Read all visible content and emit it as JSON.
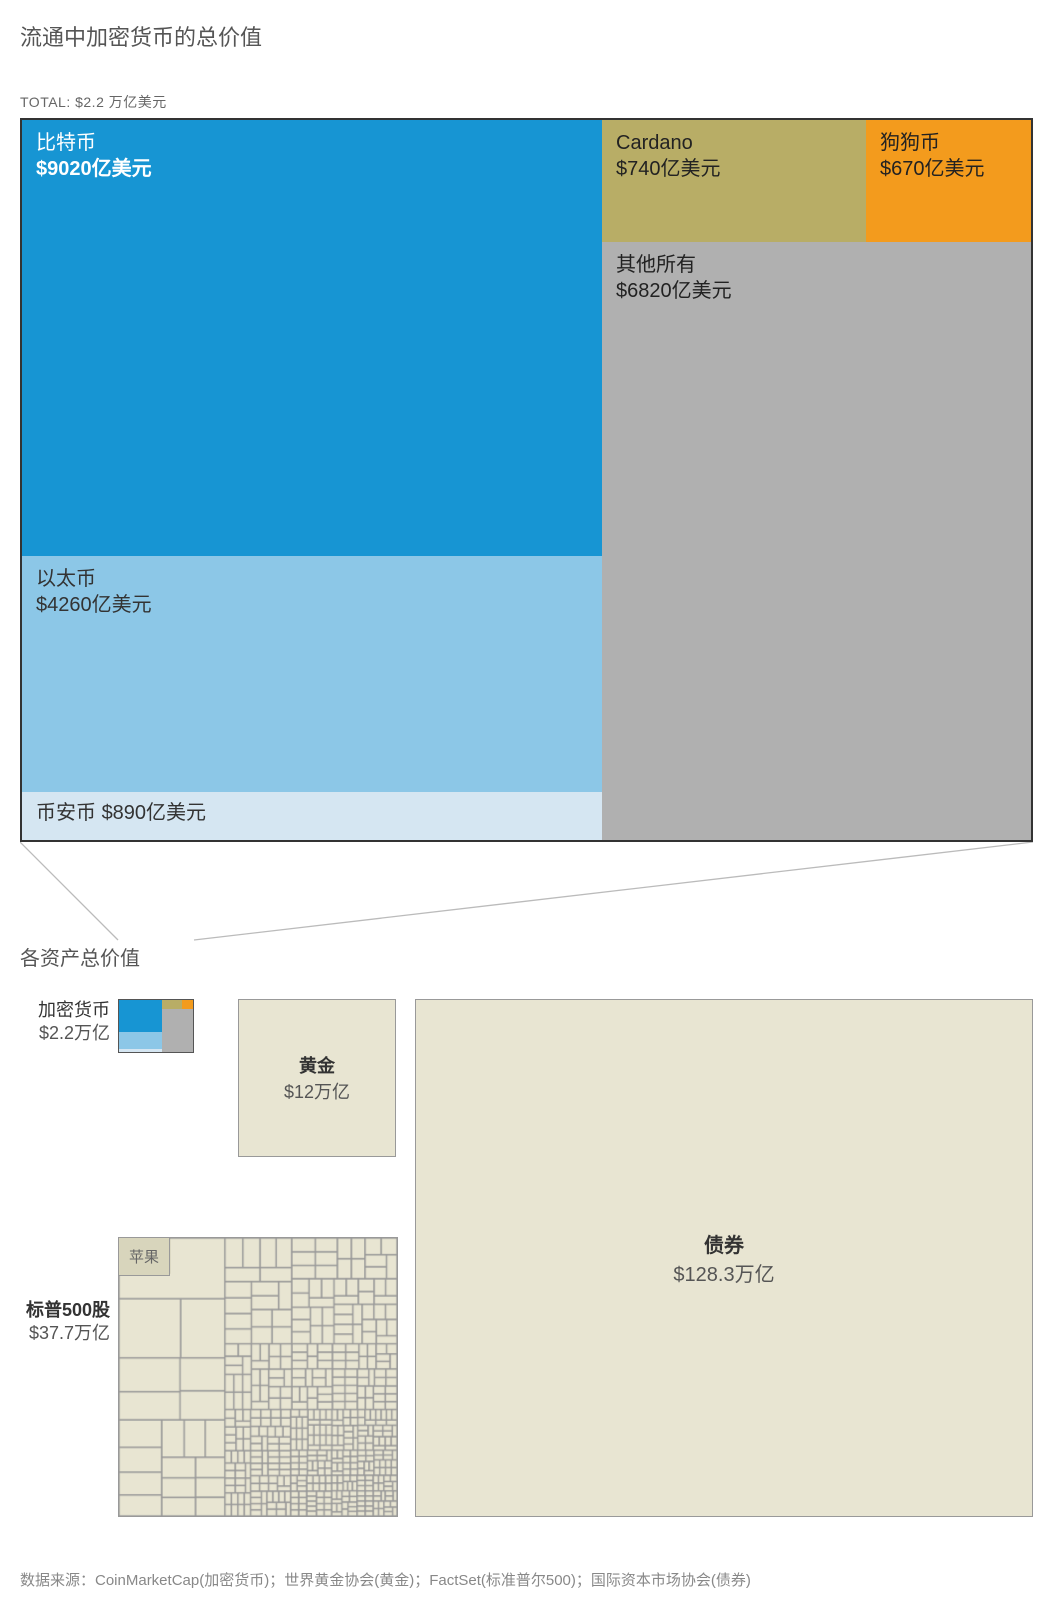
{
  "title": "流通中加密货币的总价值",
  "total_label": "TOTAL: $2.2 万亿美元",
  "crypto": {
    "bitcoin": {
      "name": "比特币",
      "value": "$9020亿美元"
    },
    "ether": {
      "name": "以太币",
      "value": "$4260亿美元"
    },
    "binance": {
      "name": "币安币",
      "value": "$890亿美元"
    },
    "cardano": {
      "name": "Cardano",
      "value": "$740亿美元"
    },
    "doge": {
      "name": "狗狗币",
      "value": "$670亿美元"
    },
    "other": {
      "name": "其他所有",
      "value": "$6820亿美元"
    }
  },
  "section2_title": "各资产总价值",
  "assets": {
    "crypto": {
      "name": "加密货币",
      "value": "$2.2万亿"
    },
    "gold": {
      "name": "黄金",
      "value": "$12万亿"
    },
    "sp500": {
      "name": "标普500股",
      "value": "$37.7万亿",
      "apple": "苹果"
    },
    "bonds": {
      "name": "债券",
      "value": "$128.3万亿"
    }
  },
  "source": "数据来源：CoinMarketCap(加密货币)；世界黄金协会(黄金)；FactSet(标准普尔500)；国际资本市场协会(债券)",
  "colors": {
    "bitcoin": "#1795d3",
    "ether": "#8cc7e7",
    "binance": "#d5e6f2",
    "cardano": "#b8ad66",
    "doge": "#f39b1d",
    "other": "#b0b0b0",
    "neutral": "#e8e5d2"
  },
  "chart_data": [
    {
      "type": "treemap",
      "title": "流通中加密货币的总价值",
      "total_label": "TOTAL",
      "total_value_usd_trillion": 2.2,
      "unit": "亿美元",
      "items": [
        {
          "name": "比特币",
          "value_usd_100m": 9020
        },
        {
          "name": "以太币",
          "value_usd_100m": 4260
        },
        {
          "name": "币安币",
          "value_usd_100m": 890
        },
        {
          "name": "Cardano",
          "value_usd_100m": 740
        },
        {
          "name": "狗狗币",
          "value_usd_100m": 670
        },
        {
          "name": "其他所有",
          "value_usd_100m": 6820
        }
      ]
    },
    {
      "type": "area-comparison",
      "title": "各资产总价值",
      "unit": "万亿美元",
      "items": [
        {
          "name": "加密货币",
          "value_usd_trillion": 2.2
        },
        {
          "name": "黄金",
          "value_usd_trillion": 12
        },
        {
          "name": "标普500股",
          "value_usd_trillion": 37.7,
          "highlight": "苹果"
        },
        {
          "name": "债券",
          "value_usd_trillion": 128.3
        }
      ]
    }
  ]
}
